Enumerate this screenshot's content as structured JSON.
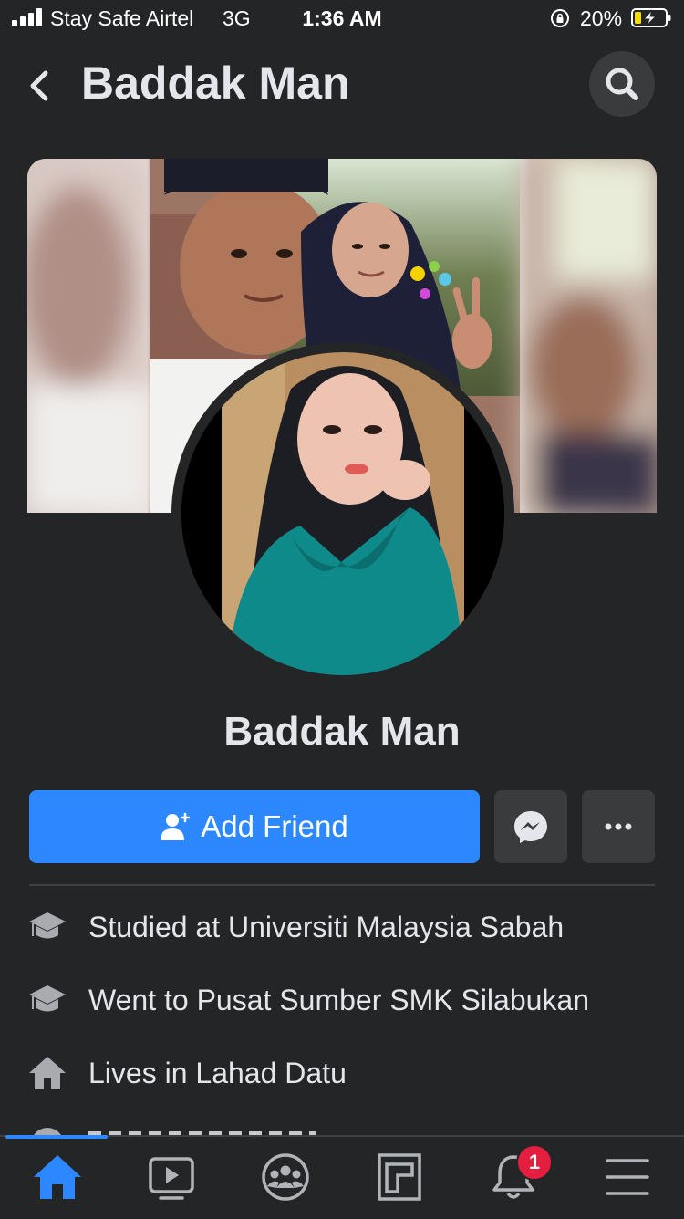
{
  "status_bar": {
    "carrier": "Stay Safe Airtel",
    "network": "3G",
    "time": "1:36 AM",
    "battery": "20%"
  },
  "header": {
    "title": "Baddak Man"
  },
  "profile": {
    "name": "Baddak Man"
  },
  "actions": {
    "add_friend_label": "Add Friend"
  },
  "details": [
    {
      "icon": "graduation-cap-icon",
      "prefix": "Studied at ",
      "value": "Universiti Malaysia Sabah"
    },
    {
      "icon": "graduation-cap-icon",
      "prefix": "Went to ",
      "value": "Pusat Sumber SMK Silabukan"
    },
    {
      "icon": "home-icon",
      "prefix": "Lives in ",
      "value": "Lahad Datu"
    }
  ],
  "tab_bar": {
    "items": [
      "home-icon",
      "video-icon",
      "groups-icon",
      "pages-icon",
      "notifications-icon",
      "menu-icon"
    ],
    "notification_count": "1"
  },
  "colors": {
    "background": "#242526",
    "accent": "#2d88ff",
    "button_secondary": "#3a3b3c",
    "badge": "#e41e3f"
  }
}
